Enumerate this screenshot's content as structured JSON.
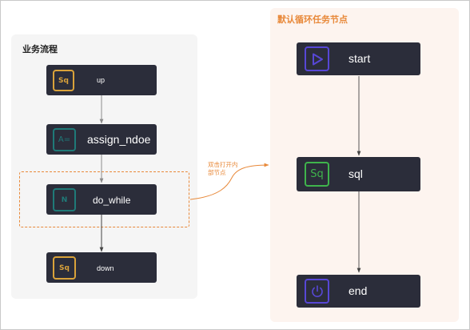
{
  "left_panel": {
    "title": "业务流程",
    "nodes": [
      {
        "id": "up",
        "badge": "Sq",
        "label": "up"
      },
      {
        "id": "assign",
        "badge": "A=",
        "label": "assign_ndoe"
      },
      {
        "id": "do_while",
        "badge": "N",
        "label": "do_while"
      },
      {
        "id": "down",
        "badge": "Sq",
        "label": "down"
      }
    ]
  },
  "hint_text": "双击打开内部节点",
  "right_panel": {
    "title": "默认循环任务节点",
    "nodes": [
      {
        "id": "start",
        "icon": "play-icon",
        "label": "start"
      },
      {
        "id": "sql",
        "badge": "Sq",
        "label": "sql"
      },
      {
        "id": "end",
        "icon": "power-icon",
        "label": "end"
      }
    ]
  },
  "colors": {
    "node_bg": "#2b2d3a",
    "orange": "#e8893a",
    "teal": "#1f7a78",
    "green": "#3fb44c",
    "purple": "#5747d6",
    "yellow": "#d9a23a"
  }
}
